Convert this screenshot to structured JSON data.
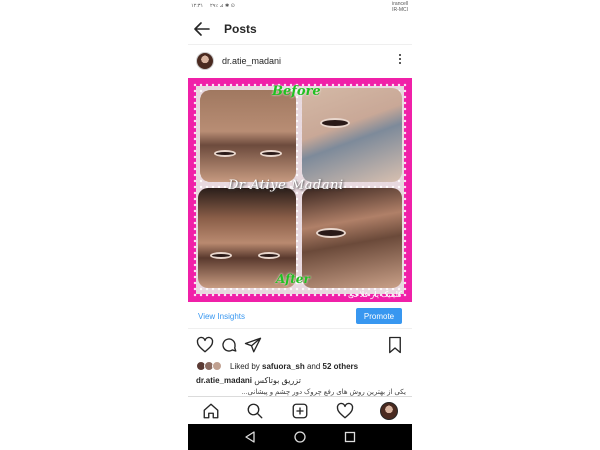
{
  "status_bar": {
    "time": "۱۲:۳۱",
    "indicators": "۲۹٪ ⊿ ✱ ⊙",
    "carrier_line1": "irancell",
    "carrier_line2": "IR-MCI"
  },
  "header": {
    "back_icon": "back-arrow-icon",
    "title": "Posts"
  },
  "post": {
    "username": "dr.atie_madani",
    "image_texts": {
      "before": "Before",
      "watermark": "Dr Atiye Madani",
      "after": "After",
      "persian": "کلینیک یار فلاحی"
    },
    "view_insights": "View Insights",
    "promote": "Promote",
    "likes": {
      "prefix": "Liked by ",
      "user": "safuora_sh",
      "middle": " and ",
      "others": "52 others"
    },
    "caption": {
      "user": "dr.atie_madani",
      "text": "تزریق بوتاکس",
      "second_line": "یکی از بهترین روش های رفع چروک دور چشم و پیشانی..."
    }
  },
  "colors": {
    "frame": "#f020a8",
    "accent": "#3897f0",
    "label_green": "#22c022"
  },
  "icons": {
    "actions": [
      "heart-icon",
      "comment-icon",
      "share-icon",
      "bookmark-icon"
    ],
    "bottom_nav": [
      "home-icon",
      "search-icon",
      "add-post-icon",
      "activity-heart-icon",
      "profile-avatar-icon"
    ],
    "android": [
      "back-triangle-icon",
      "home-circle-icon",
      "recents-square-icon"
    ]
  }
}
